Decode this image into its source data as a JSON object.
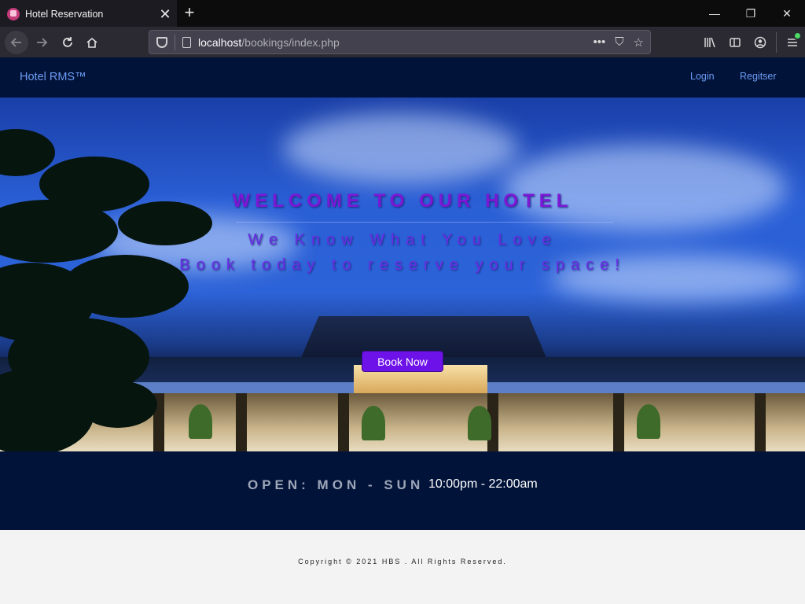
{
  "browser": {
    "tab_title": "Hotel Reservation",
    "tab_close": "✕",
    "new_tab": "+",
    "url_host": "localhost",
    "url_path": "/bookings/index.php",
    "window_controls": {
      "minimize": "—",
      "maximize": "❐",
      "close": "✕"
    },
    "url_actions": {
      "more": "•••",
      "pocket": "⛉",
      "bookmark": "☆"
    }
  },
  "site": {
    "brand": "Hotel RMS™",
    "nav": {
      "login": "Login",
      "register": "Regitser"
    }
  },
  "hero": {
    "heading": "WELCOME TO OUR HOTEL",
    "tagline_1": "We Know What You Love",
    "tagline_2": "Book today to reserve your space!",
    "cta": "Book Now"
  },
  "hours": {
    "label": "OPEN: MON - SUN",
    "time": "10:00pm - 22:00am"
  },
  "footer": {
    "copyright": "Copyright © 2021 HBS . All Rights Reserved."
  },
  "colors": {
    "nav_bg": "#02133a",
    "link": "#6b9cf2",
    "heading": "#7b18d6",
    "cta_bg": "#6d12e8"
  }
}
